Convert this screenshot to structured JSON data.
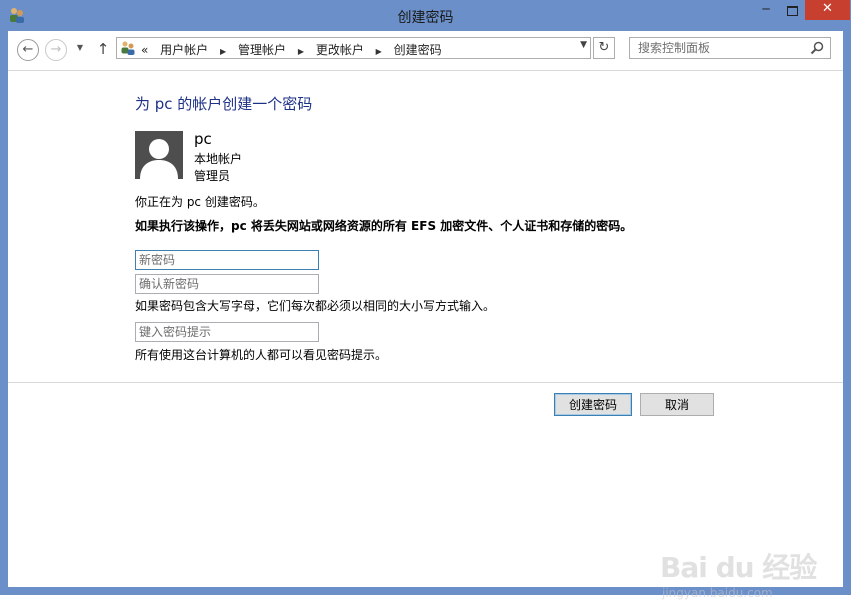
{
  "window": {
    "title": "创建密码",
    "minimize_symbol": "─",
    "close_symbol": "✕"
  },
  "addressbar": {
    "back_symbol": "←",
    "forward_symbol": "→",
    "up_symbol": "↑",
    "overflow_symbol": "«",
    "breadcrumbs": [
      "用户帐户",
      "管理帐户",
      "更改帐户",
      "创建密码"
    ],
    "refresh_symbol": "↻",
    "search_placeholder": "搜索控制面板"
  },
  "content": {
    "heading": "为 pc 的帐户创建一个密码",
    "user": {
      "name": "pc",
      "account_type": "本地帐户",
      "role": "管理员"
    },
    "info_message": "你正在为 pc 创建密码。",
    "warning_message": "如果执行该操作，pc 将丢失网站或网络资源的所有 EFS 加密文件、个人证书和存储的密码。",
    "new_password_placeholder": "新密码",
    "confirm_password_placeholder": "确认新密码",
    "case_note": "如果密码包含大写字母，它们每次都必须以相同的大小写方式输入。",
    "hint_placeholder": "键入密码提示",
    "hint_note": "所有使用这台计算机的人都可以看见密码提示。"
  },
  "buttons": {
    "create": "创建密码",
    "cancel": "取消"
  },
  "watermark": {
    "text": "Bai du 经验",
    "url": "jingyan.baidu.com"
  },
  "colors": {
    "window_frame": "#6b8fc9",
    "heading": "#1e3287",
    "close_button": "#c7402f",
    "focus_border": "#3c7fb1"
  }
}
